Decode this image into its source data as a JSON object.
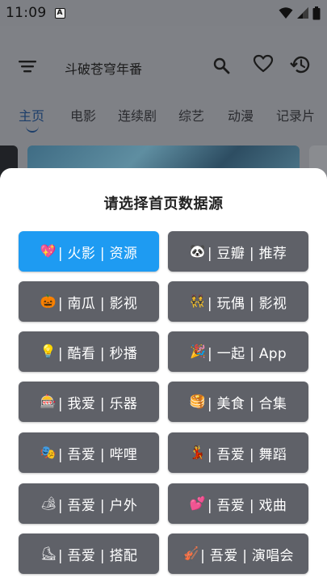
{
  "status_bar": {
    "time": "11:09",
    "notification_letter": "A"
  },
  "header": {
    "search_text": "斗破苍穹年番"
  },
  "tabs": [
    {
      "label": "主页",
      "active": true
    },
    {
      "label": "电影"
    },
    {
      "label": "连续剧"
    },
    {
      "label": "综艺"
    },
    {
      "label": "动漫"
    },
    {
      "label": "记录片"
    }
  ],
  "sheet": {
    "title": "请选择首页数据源",
    "sources": [
      {
        "icon": "💖",
        "label": "| 火影 | 资源",
        "active": true
      },
      {
        "icon": "🐼",
        "label": "| 豆瓣 | 推荐"
      },
      {
        "icon": "🎃",
        "label": "| 南瓜 | 影视"
      },
      {
        "icon": "👯",
        "label": "| 玩偶 | 影视"
      },
      {
        "icon": "💡",
        "label": "| 酷看 | 秒播"
      },
      {
        "icon": "🎉",
        "label": "| 一起 | App"
      },
      {
        "icon": "🎰",
        "label": "| 我爱 | 乐器"
      },
      {
        "icon": "🥞",
        "label": "| 美食 | 合集"
      },
      {
        "icon": "🎭",
        "label": "| 吾爱 | 哔哩"
      },
      {
        "icon": "💃",
        "label": "| 吾爱 | 舞蹈"
      },
      {
        "icon": "🏕",
        "label": "| 吾爱 | 户外"
      },
      {
        "icon": "💕",
        "label": "| 吾爱 | 戏曲"
      },
      {
        "icon": "⛸",
        "label": "| 吾爱 | 搭配"
      },
      {
        "icon": "🎻",
        "label": "| 吾爱 | 演唱会"
      }
    ]
  },
  "colors": {
    "accent": "#1e9bf2",
    "button": "#5f6168",
    "scrim": "#7f8186",
    "active_tab": "#1c3e6a"
  }
}
